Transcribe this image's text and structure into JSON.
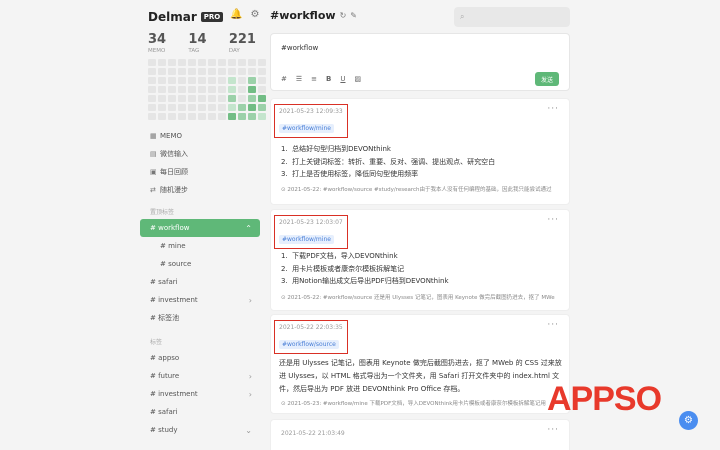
{
  "brand": {
    "name": "Delmar",
    "badge": "PRO"
  },
  "stats": [
    {
      "value": "34",
      "label": "MEMO"
    },
    {
      "value": "14",
      "label": "TAG"
    },
    {
      "value": "221",
      "label": "DAY"
    }
  ],
  "sidebar": {
    "items": [
      {
        "label": "MEMO"
      },
      {
        "label": "微信输入"
      },
      {
        "label": "每日回顾"
      },
      {
        "label": "随机漫步"
      }
    ],
    "fav_title": "置顶标签",
    "fav": [
      {
        "label": "# workflow"
      },
      {
        "label": "# mine"
      },
      {
        "label": "# source"
      },
      {
        "label": "# safari"
      },
      {
        "label": "# investment"
      },
      {
        "label": "# 标签池"
      }
    ],
    "tags_title": "标签",
    "tags": [
      {
        "label": "# appso"
      },
      {
        "label": "# future"
      },
      {
        "label": "# investment"
      },
      {
        "label": "# safari"
      },
      {
        "label": "# study"
      }
    ]
  },
  "header": {
    "title": "#workflow"
  },
  "editor": {
    "content": "#workflow",
    "send_label": "发送"
  },
  "cards": [
    {
      "date": "2021-05-23 12:09:33",
      "tag": "#workflow/mine",
      "items": [
        "总结好句型归档到DEVONthink",
        "打上关键词标签：转折、重要、反对、强调、提出观点、研究空白",
        "打上是否使用标签，降低同句型使用频率"
      ],
      "ref": "2021-05-22: #workflow/source #study/research由于我本人没有任何编程的基础，因此我只能尝试通过"
    },
    {
      "date": "2021-05-23 12:03:07",
      "tag": "#workflow/mine",
      "items": [
        "下载PDF文档，导入DEVONthink",
        "用卡片模板或者康奈尔模板拆解笔记",
        "用Notion输出成文后导出PDF归档到DEVONthink"
      ],
      "ref": "2021-05-22: #workflow/source 还是用 Ulysses 记笔记，图表用 Keynote 做完后截图扔进去，抠了 MWe"
    },
    {
      "date": "2021-05-22 22:03:35",
      "tag": "#workflow/source",
      "para": "还是用 Ulysses 记笔记，图表用 Keynote 做完后截图扔进去，抠了 MWeb 的 CSS 过来放进 Ulysses，以 HTML 格式导出为一个文件夹，用 Safari 打开文件夹中的 index.html 文件，然后导出为 PDF 放进 DEVONthink Pro Office 存档。",
      "ref": "2021-05-23: #workflow/mine 下载PDF文档，导入DEVONthink用卡片模板或者康奈尔模板拆解笔记用"
    },
    {
      "date": "2021-05-22 21:03:49"
    }
  ],
  "watermark": "APPSO",
  "colors": {
    "accent": "#5fb878",
    "highlight_box": "#d93025",
    "tag_blue": "#4a7fd6"
  }
}
